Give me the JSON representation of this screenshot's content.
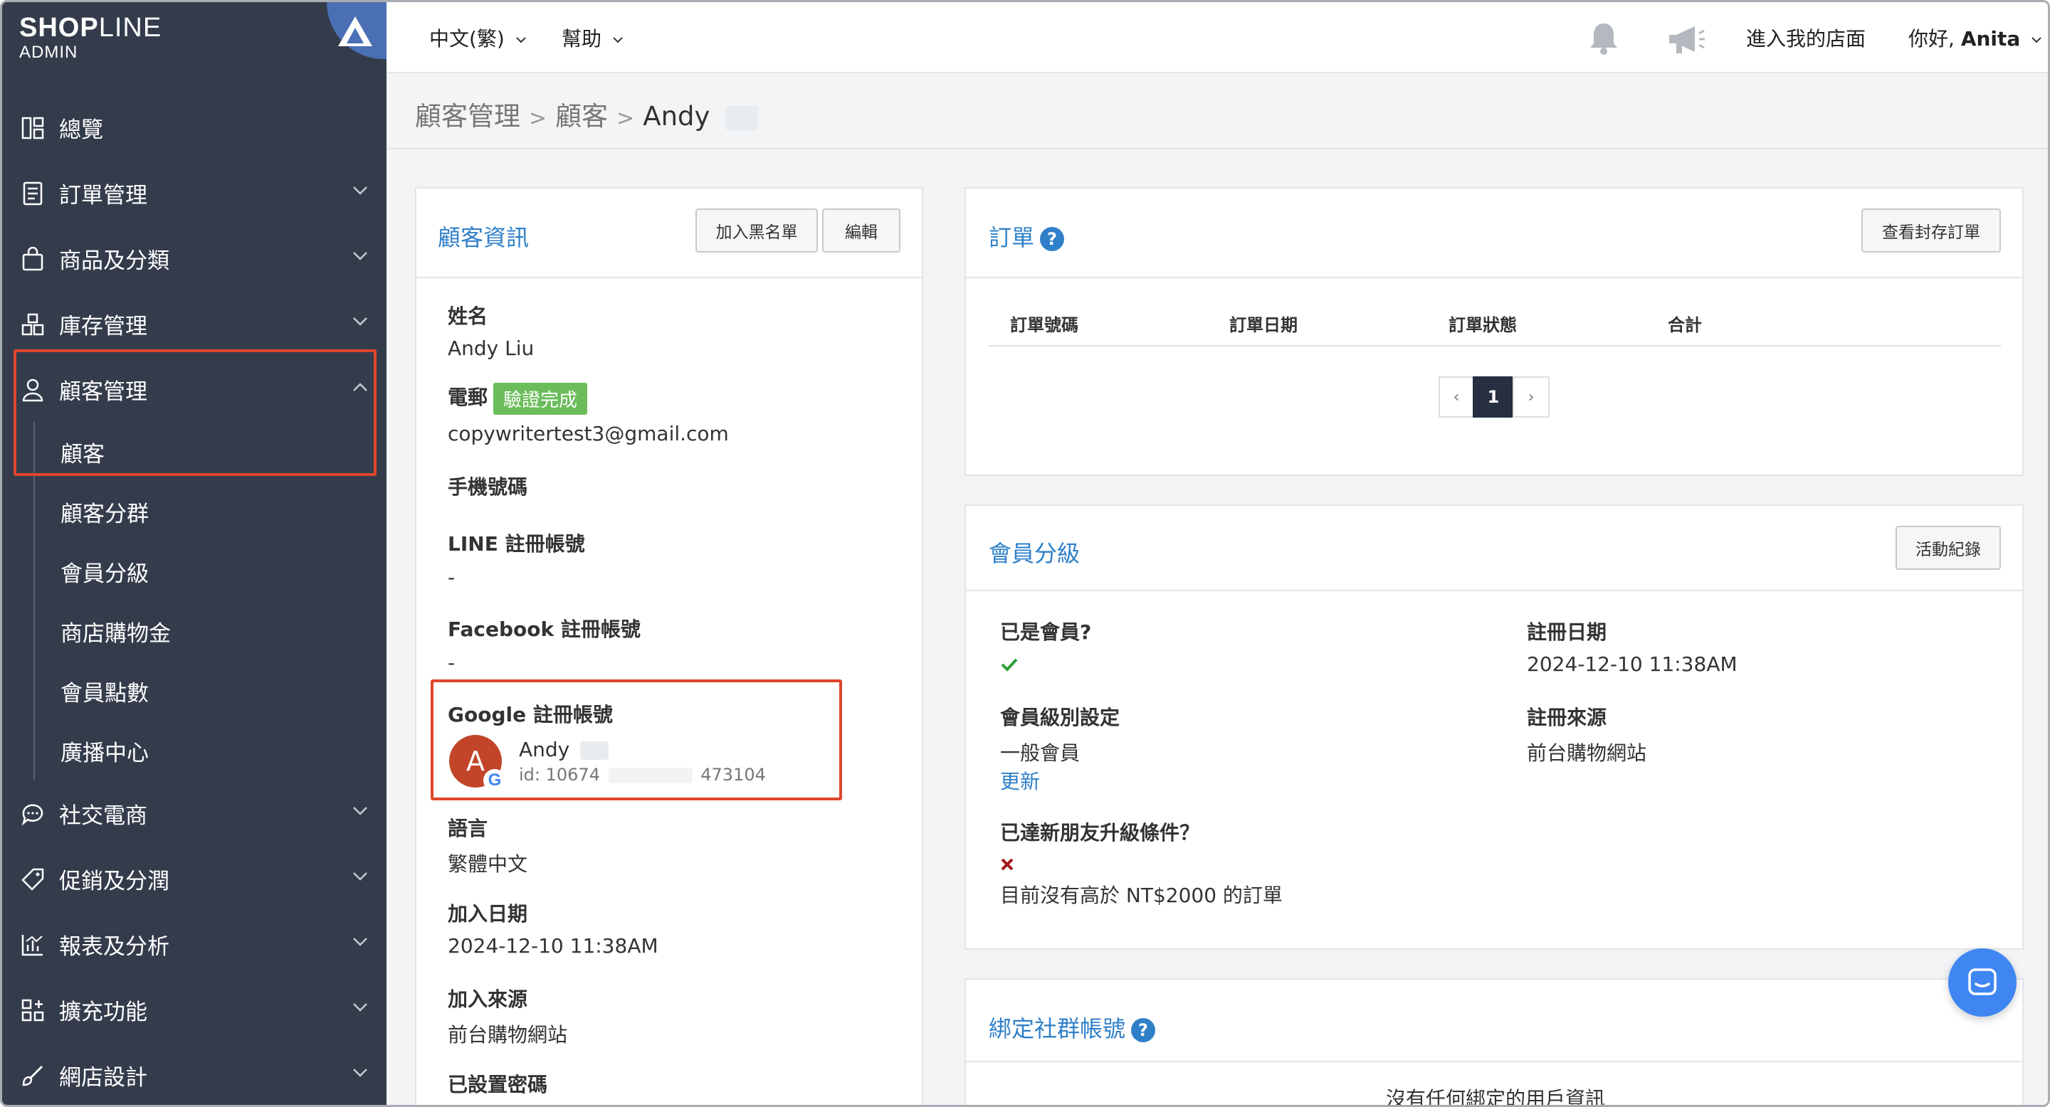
{
  "brand": {
    "logo_bold": "SHOP",
    "logo_light": "LINE",
    "logo_sub": "ADMIN"
  },
  "sidebar": {
    "items": [
      {
        "label": "總覽",
        "icon": "dashboard-icon"
      },
      {
        "label": "訂單管理",
        "icon": "orders-icon"
      },
      {
        "label": "商品及分類",
        "icon": "bag-icon"
      },
      {
        "label": "庫存管理",
        "icon": "inventory-icon"
      },
      {
        "label": "顧客管理",
        "icon": "user-icon"
      }
    ],
    "sub_items": [
      "顧客",
      "顧客分群",
      "會員分級",
      "商店購物金",
      "會員點數",
      "廣播中心"
    ],
    "items_after": [
      {
        "label": "社交電商",
        "icon": "chat-bubble-icon"
      },
      {
        "label": "促銷及分潤",
        "icon": "tag-icon"
      },
      {
        "label": "報表及分析",
        "icon": "chart-icon"
      },
      {
        "label": "擴充功能",
        "icon": "apps-icon"
      },
      {
        "label": "網店設計",
        "icon": "brush-icon"
      }
    ]
  },
  "topbar": {
    "language": "中文(繁)",
    "help": "幫助",
    "visit_store": "進入我的店面",
    "greeting": "你好,",
    "user": "Anita"
  },
  "breadcrumb": {
    "level1": "顧客管理",
    "level2": "顧客",
    "current": "Andy"
  },
  "customer_info": {
    "title": "顧客資訊",
    "blacklist_button": "加入黑名單",
    "edit_button": "編輯",
    "name_label": "姓名",
    "name_value": "Andy Liu",
    "email_label": "電郵",
    "verified_badge": "驗證完成",
    "email_value": "copywritertest3@gmail.com",
    "phone_label": "手機號碼",
    "line_label": "LINE 註冊帳號",
    "line_value": "-",
    "facebook_label": "Facebook 註冊帳號",
    "facebook_value": "-",
    "google_label": "Google 註冊帳號",
    "google_avatar": "A",
    "google_name": "Andy",
    "google_id_prefix": "id: 10674",
    "google_id_suffix": "473104",
    "language_label": "語言",
    "language_value": "繁體中文",
    "join_date_label": "加入日期",
    "join_date_value": "2024-12-10 11:38AM",
    "join_source_label": "加入來源",
    "join_source_value": "前台購物網站",
    "password_label": "已設置密碼"
  },
  "orders": {
    "title": "訂單",
    "archive_button": "查看封存訂單",
    "columns": [
      "訂單號碼",
      "訂單日期",
      "訂單狀態",
      "合計"
    ],
    "pager": {
      "prev": "‹",
      "page": "1",
      "next": "›"
    }
  },
  "membership": {
    "title": "會員分級",
    "activity_button": "活動紀錄",
    "is_member_label": "已是會員?",
    "register_date_label": "註冊日期",
    "register_date_value": "2024-12-10 11:38AM",
    "tier_setting_label": "會員級別設定",
    "tier_value": "一般會員",
    "update_link": "更新",
    "register_source_label": "註冊來源",
    "register_source_value": "前台購物網站",
    "upgrade_label": "已達新朋友升級條件？",
    "upgrade_note": "目前沒有高於 NT$2000 的訂單"
  },
  "social": {
    "title": "綁定社群帳號",
    "empty": "沒有任何綁定的用戶資訊"
  },
  "colors": {
    "sidebar": "#343c4c",
    "accent": "#2f80c9",
    "highlight": "#e0452c",
    "verified": "#6bbd5b",
    "chat": "#3f86f2"
  }
}
